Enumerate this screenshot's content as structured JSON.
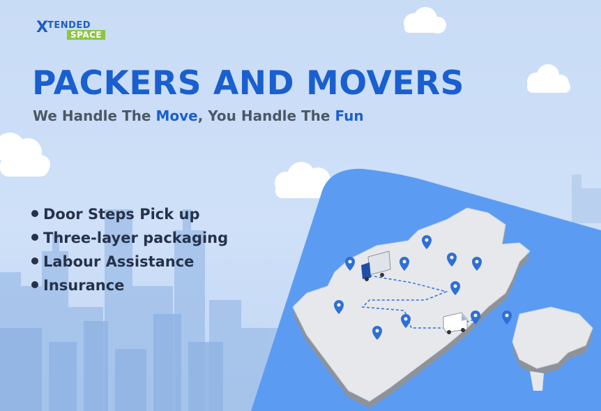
{
  "brand": {
    "logo_line1": "TENDED",
    "logo_line2": "SPACE",
    "logo_x": "X"
  },
  "headline": "PACKERS AND MOVERS",
  "tagline": {
    "part1": "We Handle The ",
    "highlight1": "Move",
    "part2": ", You Handle The ",
    "highlight2": "Fun"
  },
  "features": [
    "Door Steps Pick up",
    "Three-layer packaging",
    "Labour Assistance",
    "Insurance"
  ],
  "colors": {
    "primary_blue": "#1a5fcf",
    "panel_blue": "#5b9cf2",
    "map_gray": "#e6e8ec",
    "logo_green": "#8cc63f",
    "text_dark": "#26324a"
  },
  "icons": [
    "location-pin-icon",
    "truck-icon",
    "van-icon",
    "cloud-icon"
  ]
}
